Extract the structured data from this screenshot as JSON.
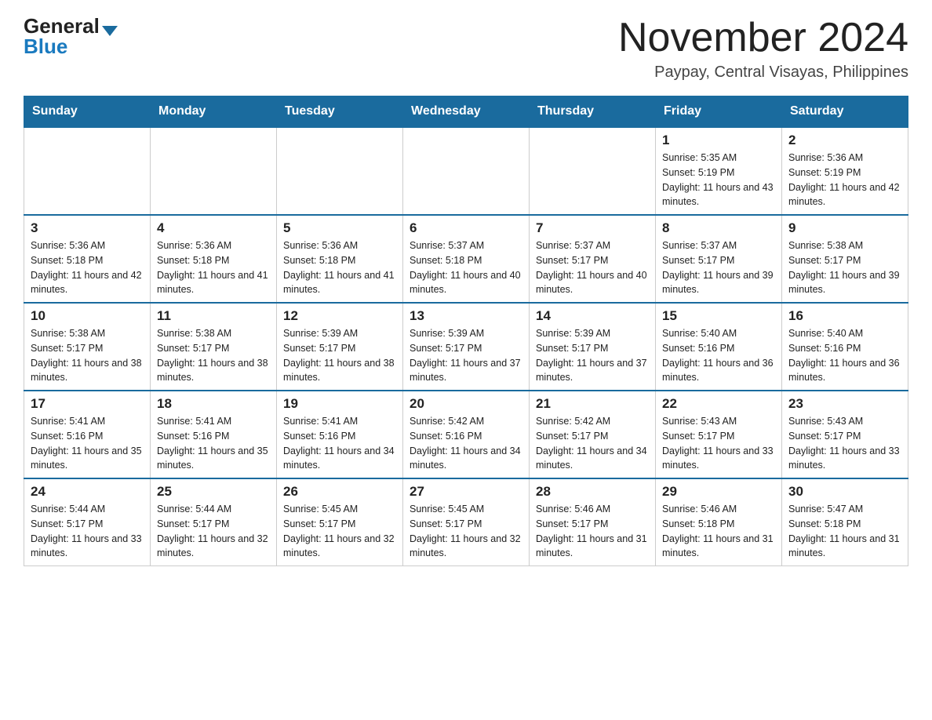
{
  "header": {
    "logo_general": "General",
    "logo_blue": "Blue",
    "title": "November 2024",
    "subtitle": "Paypay, Central Visayas, Philippines"
  },
  "days_of_week": [
    "Sunday",
    "Monday",
    "Tuesday",
    "Wednesday",
    "Thursday",
    "Friday",
    "Saturday"
  ],
  "weeks": [
    {
      "days": [
        {
          "num": "",
          "info": ""
        },
        {
          "num": "",
          "info": ""
        },
        {
          "num": "",
          "info": ""
        },
        {
          "num": "",
          "info": ""
        },
        {
          "num": "",
          "info": ""
        },
        {
          "num": "1",
          "info": "Sunrise: 5:35 AM\nSunset: 5:19 PM\nDaylight: 11 hours and 43 minutes."
        },
        {
          "num": "2",
          "info": "Sunrise: 5:36 AM\nSunset: 5:19 PM\nDaylight: 11 hours and 42 minutes."
        }
      ]
    },
    {
      "days": [
        {
          "num": "3",
          "info": "Sunrise: 5:36 AM\nSunset: 5:18 PM\nDaylight: 11 hours and 42 minutes."
        },
        {
          "num": "4",
          "info": "Sunrise: 5:36 AM\nSunset: 5:18 PM\nDaylight: 11 hours and 41 minutes."
        },
        {
          "num": "5",
          "info": "Sunrise: 5:36 AM\nSunset: 5:18 PM\nDaylight: 11 hours and 41 minutes."
        },
        {
          "num": "6",
          "info": "Sunrise: 5:37 AM\nSunset: 5:18 PM\nDaylight: 11 hours and 40 minutes."
        },
        {
          "num": "7",
          "info": "Sunrise: 5:37 AM\nSunset: 5:17 PM\nDaylight: 11 hours and 40 minutes."
        },
        {
          "num": "8",
          "info": "Sunrise: 5:37 AM\nSunset: 5:17 PM\nDaylight: 11 hours and 39 minutes."
        },
        {
          "num": "9",
          "info": "Sunrise: 5:38 AM\nSunset: 5:17 PM\nDaylight: 11 hours and 39 minutes."
        }
      ]
    },
    {
      "days": [
        {
          "num": "10",
          "info": "Sunrise: 5:38 AM\nSunset: 5:17 PM\nDaylight: 11 hours and 38 minutes."
        },
        {
          "num": "11",
          "info": "Sunrise: 5:38 AM\nSunset: 5:17 PM\nDaylight: 11 hours and 38 minutes."
        },
        {
          "num": "12",
          "info": "Sunrise: 5:39 AM\nSunset: 5:17 PM\nDaylight: 11 hours and 38 minutes."
        },
        {
          "num": "13",
          "info": "Sunrise: 5:39 AM\nSunset: 5:17 PM\nDaylight: 11 hours and 37 minutes."
        },
        {
          "num": "14",
          "info": "Sunrise: 5:39 AM\nSunset: 5:17 PM\nDaylight: 11 hours and 37 minutes."
        },
        {
          "num": "15",
          "info": "Sunrise: 5:40 AM\nSunset: 5:16 PM\nDaylight: 11 hours and 36 minutes."
        },
        {
          "num": "16",
          "info": "Sunrise: 5:40 AM\nSunset: 5:16 PM\nDaylight: 11 hours and 36 minutes."
        }
      ]
    },
    {
      "days": [
        {
          "num": "17",
          "info": "Sunrise: 5:41 AM\nSunset: 5:16 PM\nDaylight: 11 hours and 35 minutes."
        },
        {
          "num": "18",
          "info": "Sunrise: 5:41 AM\nSunset: 5:16 PM\nDaylight: 11 hours and 35 minutes."
        },
        {
          "num": "19",
          "info": "Sunrise: 5:41 AM\nSunset: 5:16 PM\nDaylight: 11 hours and 34 minutes."
        },
        {
          "num": "20",
          "info": "Sunrise: 5:42 AM\nSunset: 5:16 PM\nDaylight: 11 hours and 34 minutes."
        },
        {
          "num": "21",
          "info": "Sunrise: 5:42 AM\nSunset: 5:17 PM\nDaylight: 11 hours and 34 minutes."
        },
        {
          "num": "22",
          "info": "Sunrise: 5:43 AM\nSunset: 5:17 PM\nDaylight: 11 hours and 33 minutes."
        },
        {
          "num": "23",
          "info": "Sunrise: 5:43 AM\nSunset: 5:17 PM\nDaylight: 11 hours and 33 minutes."
        }
      ]
    },
    {
      "days": [
        {
          "num": "24",
          "info": "Sunrise: 5:44 AM\nSunset: 5:17 PM\nDaylight: 11 hours and 33 minutes."
        },
        {
          "num": "25",
          "info": "Sunrise: 5:44 AM\nSunset: 5:17 PM\nDaylight: 11 hours and 32 minutes."
        },
        {
          "num": "26",
          "info": "Sunrise: 5:45 AM\nSunset: 5:17 PM\nDaylight: 11 hours and 32 minutes."
        },
        {
          "num": "27",
          "info": "Sunrise: 5:45 AM\nSunset: 5:17 PM\nDaylight: 11 hours and 32 minutes."
        },
        {
          "num": "28",
          "info": "Sunrise: 5:46 AM\nSunset: 5:17 PM\nDaylight: 11 hours and 31 minutes."
        },
        {
          "num": "29",
          "info": "Sunrise: 5:46 AM\nSunset: 5:18 PM\nDaylight: 11 hours and 31 minutes."
        },
        {
          "num": "30",
          "info": "Sunrise: 5:47 AM\nSunset: 5:18 PM\nDaylight: 11 hours and 31 minutes."
        }
      ]
    }
  ]
}
